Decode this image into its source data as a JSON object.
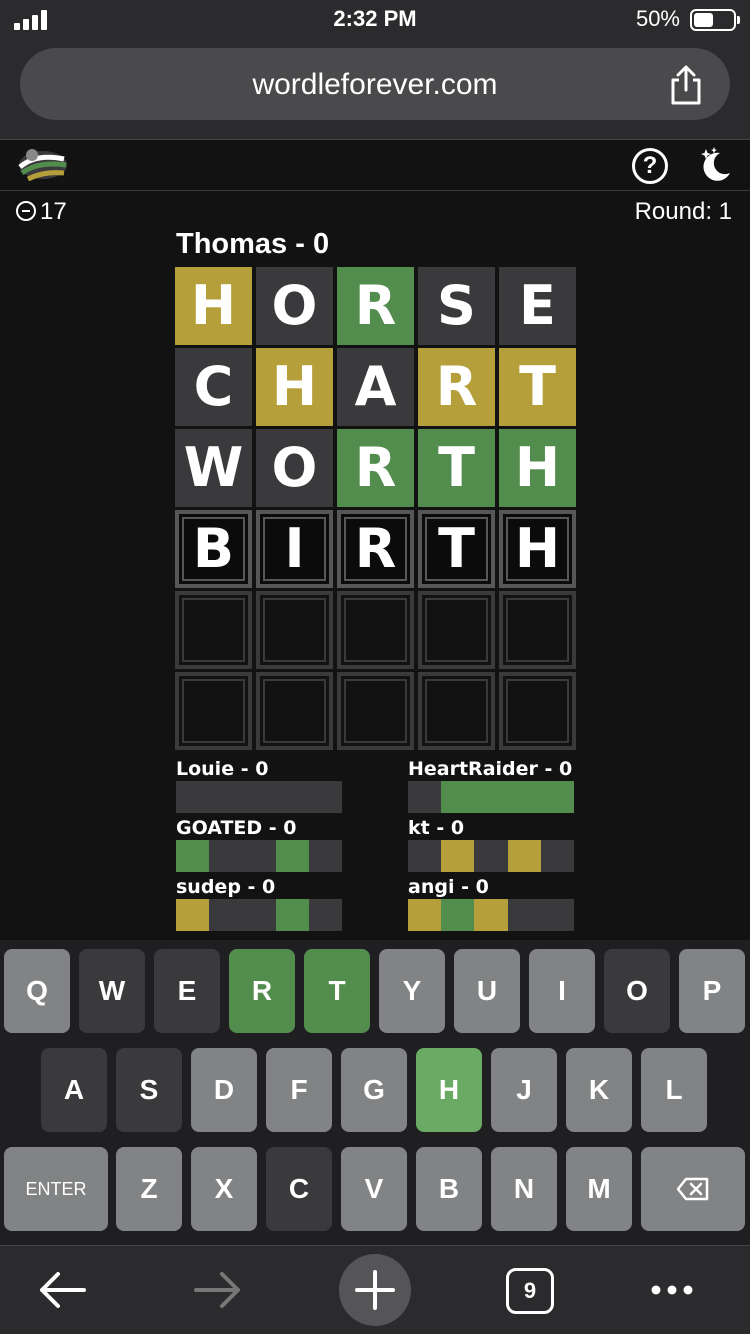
{
  "status": {
    "time": "2:32 PM",
    "battery": "50%",
    "battery_level": 0.5
  },
  "browser": {
    "url": "wordleforever.com",
    "tab_count": "9"
  },
  "game": {
    "timer": "17",
    "round": "Round: 1",
    "player": "Thomas - 0",
    "board": [
      [
        [
          "H",
          "present"
        ],
        [
          "O",
          "absent"
        ],
        [
          "R",
          "correct"
        ],
        [
          "S",
          "absent"
        ],
        [
          "E",
          "absent"
        ]
      ],
      [
        [
          "C",
          "absent"
        ],
        [
          "H",
          "present"
        ],
        [
          "A",
          "absent"
        ],
        [
          "R",
          "present"
        ],
        [
          "T",
          "present"
        ]
      ],
      [
        [
          "W",
          "absent"
        ],
        [
          "O",
          "absent"
        ],
        [
          "R",
          "correct"
        ],
        [
          "T",
          "correct"
        ],
        [
          "H",
          "correct"
        ]
      ],
      [
        [
          "B",
          "tbd"
        ],
        [
          "I",
          "tbd"
        ],
        [
          "R",
          "tbd"
        ],
        [
          "T",
          "tbd"
        ],
        [
          "H",
          "tbd"
        ]
      ],
      [
        [
          "",
          "empty"
        ],
        [
          "",
          "empty"
        ],
        [
          "",
          "empty"
        ],
        [
          "",
          "empty"
        ],
        [
          "",
          "empty"
        ]
      ],
      [
        [
          "",
          "empty"
        ],
        [
          "",
          "empty"
        ],
        [
          "",
          "empty"
        ],
        [
          "",
          "empty"
        ],
        [
          "",
          "empty"
        ]
      ]
    ],
    "opponents": [
      {
        "name": "Louie - 0",
        "row": [
          "#3a3a3c",
          "#3a3a3c",
          "#3a3a3c",
          "#3a3a3c",
          "#3a3a3c"
        ]
      },
      {
        "name": "HeartRaider - 0",
        "row": [
          "#3a3a3c",
          "#538d4e",
          "#538d4e",
          "#538d4e",
          "#538d4e"
        ]
      },
      {
        "name": "GOATED - 0",
        "row": [
          "#538d4e",
          "#3a3a3c",
          "#3a3a3c",
          "#538d4e",
          "#3a3a3c"
        ]
      },
      {
        "name": "kt - 0",
        "row": [
          "#3a3a3c",
          "#b59f3b",
          "#3a3a3c",
          "#b59f3b",
          "#3a3a3c"
        ]
      },
      {
        "name": "sudep - 0",
        "row": [
          "#b59f3b",
          "#3a3a3c",
          "#3a3a3c",
          "#538d4e",
          "#3a3a3c"
        ]
      },
      {
        "name": "angi - 0",
        "row": [
          "#b59f3b",
          "#538d4e",
          "#b59f3b",
          "#3a3a3c",
          "#3a3a3c"
        ]
      }
    ]
  },
  "keyboard": {
    "rows": [
      [
        [
          "Q",
          "unused"
        ],
        [
          "W",
          "absent"
        ],
        [
          "E",
          "absent"
        ],
        [
          "R",
          "correct"
        ],
        [
          "T",
          "correct"
        ],
        [
          "Y",
          "unused"
        ],
        [
          "U",
          "unused"
        ],
        [
          "I",
          "unused"
        ],
        [
          "O",
          "absent"
        ],
        [
          "P",
          "unused"
        ]
      ],
      [
        [
          "A",
          "absent"
        ],
        [
          "S",
          "absent"
        ],
        [
          "D",
          "unused"
        ],
        [
          "F",
          "unused"
        ],
        [
          "G",
          "unused"
        ],
        [
          "H",
          "bright"
        ],
        [
          "J",
          "unused"
        ],
        [
          "K",
          "unused"
        ],
        [
          "L",
          "unused"
        ]
      ],
      [
        [
          "ENTER",
          "unused"
        ],
        [
          "Z",
          "unused"
        ],
        [
          "X",
          "unused"
        ],
        [
          "C",
          "absent"
        ],
        [
          "V",
          "unused"
        ],
        [
          "B",
          "unused"
        ],
        [
          "N",
          "unused"
        ],
        [
          "M",
          "unused"
        ],
        [
          "",
          "unused"
        ]
      ]
    ]
  },
  "colors": {
    "correct": "#538d4e",
    "present": "#b59f3b",
    "absent": "#3a3a3c",
    "unused": "#818384"
  }
}
